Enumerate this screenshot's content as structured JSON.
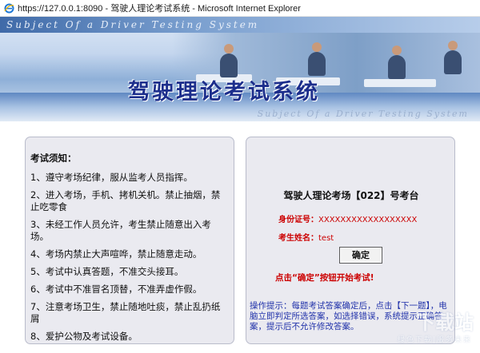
{
  "window": {
    "title": "https://127.0.0.1:8090 - 驾驶人理论考试系统 - Microsoft Internet Explorer"
  },
  "banner": {
    "subtitle_top": "Subject Of a Driver Testing System",
    "title": "驾驶理论考试系统",
    "subtitle_bottom": "Subject Of a Driver Testing System"
  },
  "notice": {
    "heading": "考试须知：",
    "rules": [
      "1、遵守考场纪律，服从监考人员指挥。",
      "2、进入考场，手机、拷机关机。禁止抽烟，禁止吃零食",
      "3、未经工作人员允许，考生禁止随意出入考场。",
      "4、考场内禁止大声喧哗，禁止随意走动。",
      "5、考试中认真答题，不准交头接耳。",
      "6、考试中不准冒名顶替，不准弄虚作假。",
      "7、注意考场卫生，禁止随地吐痰，禁止乱扔纸屑",
      "8、爱护公物及考试设备。"
    ]
  },
  "exam": {
    "room": "驾驶人理论考场【022】号考台",
    "id_label": "身份证号：",
    "id_value": "XXXXXXXXXXXXXXXXXX",
    "name_label": "考生姓名：",
    "name_value": "test",
    "confirm_label": "确定",
    "start_tip": "点击“确定”按钮开始考试!",
    "help_text": "操作提示：每题考试答案确定后，点击【下一题】，电脑立即判定所选答案，如选择错误，系统提示正确答案，提示后不允许修改答案。"
  },
  "watermark": {
    "logo": "下载站",
    "text": "绿色下载|服务未来"
  },
  "colors": {
    "title_blue": "#1c2e8c",
    "warning_red": "#cc0000",
    "help_blue": "#2233aa",
    "panel_bg": "#eaeaf0"
  },
  "icons": {
    "window": "ie-icon"
  }
}
